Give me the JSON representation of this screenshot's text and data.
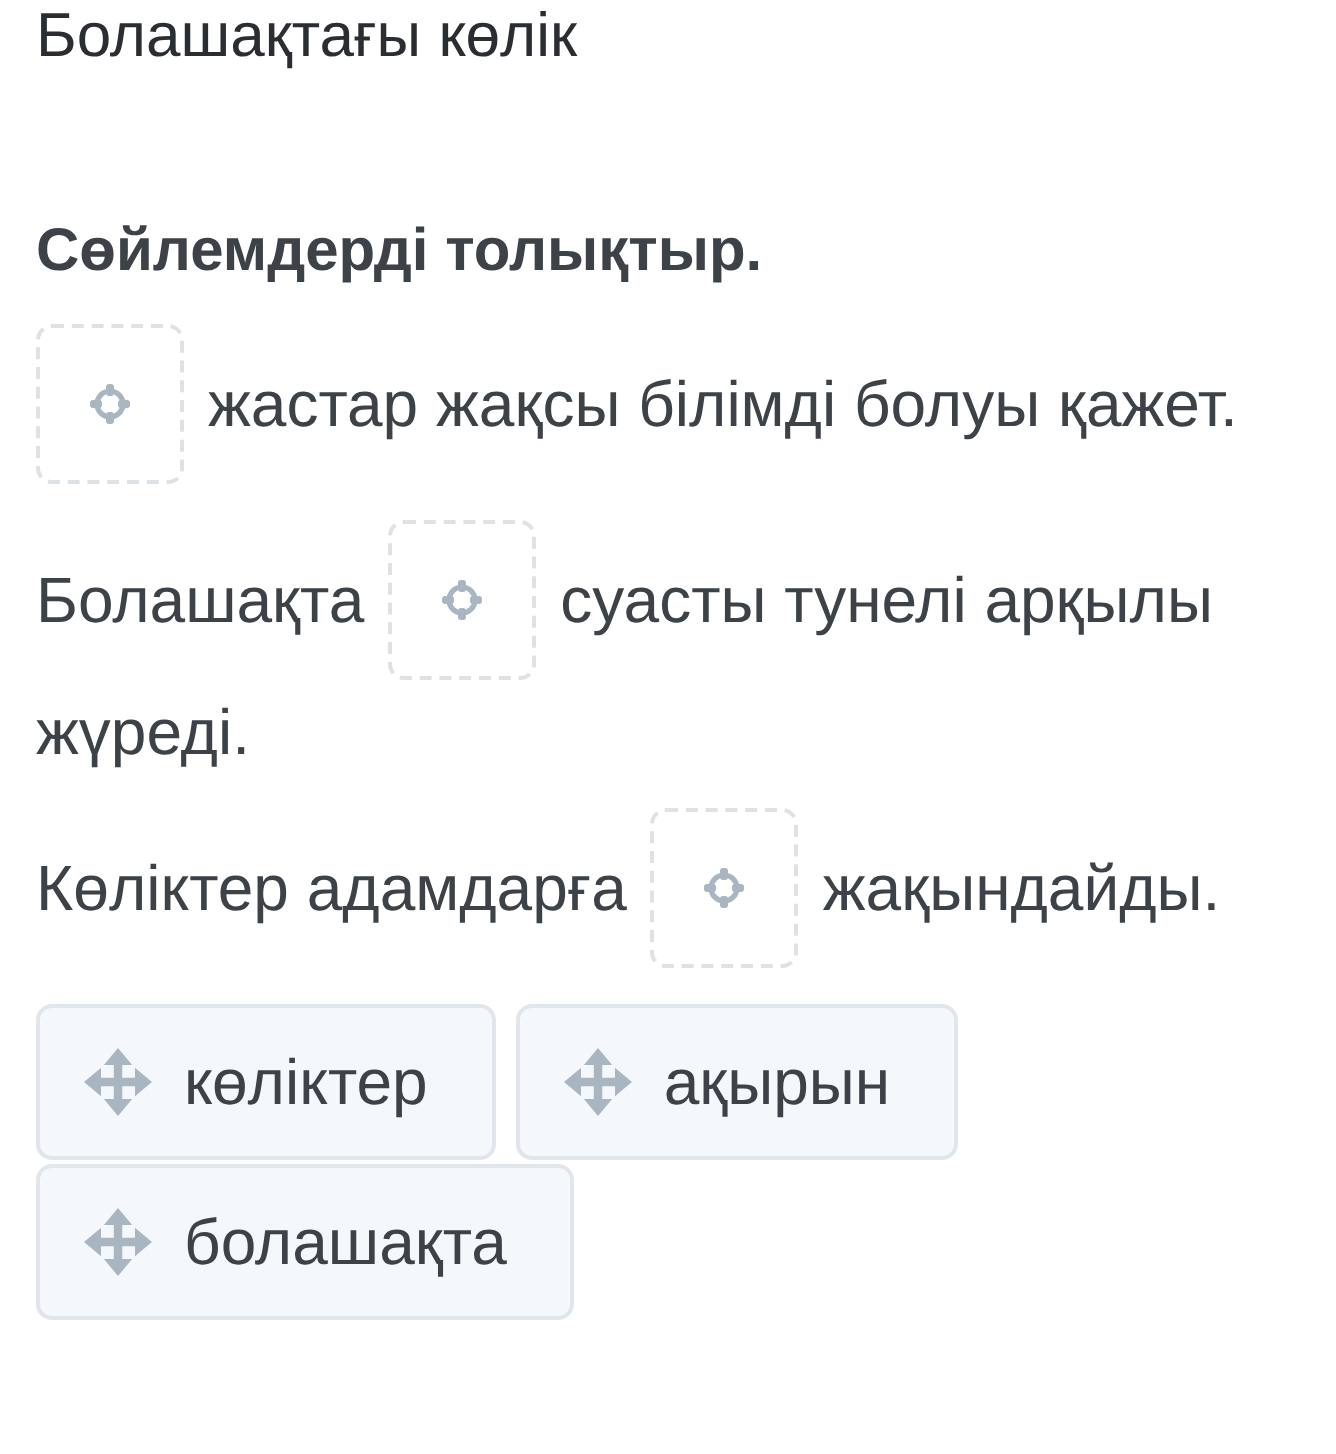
{
  "title": "Болашақтағы көлік",
  "instruction": "Сөйлемдерді толықтыр.",
  "sentences": [
    {
      "parts": [
        {
          "kind": "blank"
        },
        {
          "kind": "text",
          "text": "жастар жақсы білімді болуы қажет."
        }
      ]
    },
    {
      "parts": [
        {
          "kind": "text",
          "text": "Болашақта"
        },
        {
          "kind": "blank"
        },
        {
          "kind": "text",
          "text": "суасты тунелі арқылы"
        },
        {
          "kind": "text",
          "text": "жүреді."
        }
      ]
    },
    {
      "parts": [
        {
          "kind": "text",
          "text": "Көліктер адамдарға"
        },
        {
          "kind": "blank"
        },
        {
          "kind": "text",
          "text": "жақындайды."
        }
      ]
    }
  ],
  "options": [
    "көліктер",
    "ақырын",
    "болашақта"
  ]
}
